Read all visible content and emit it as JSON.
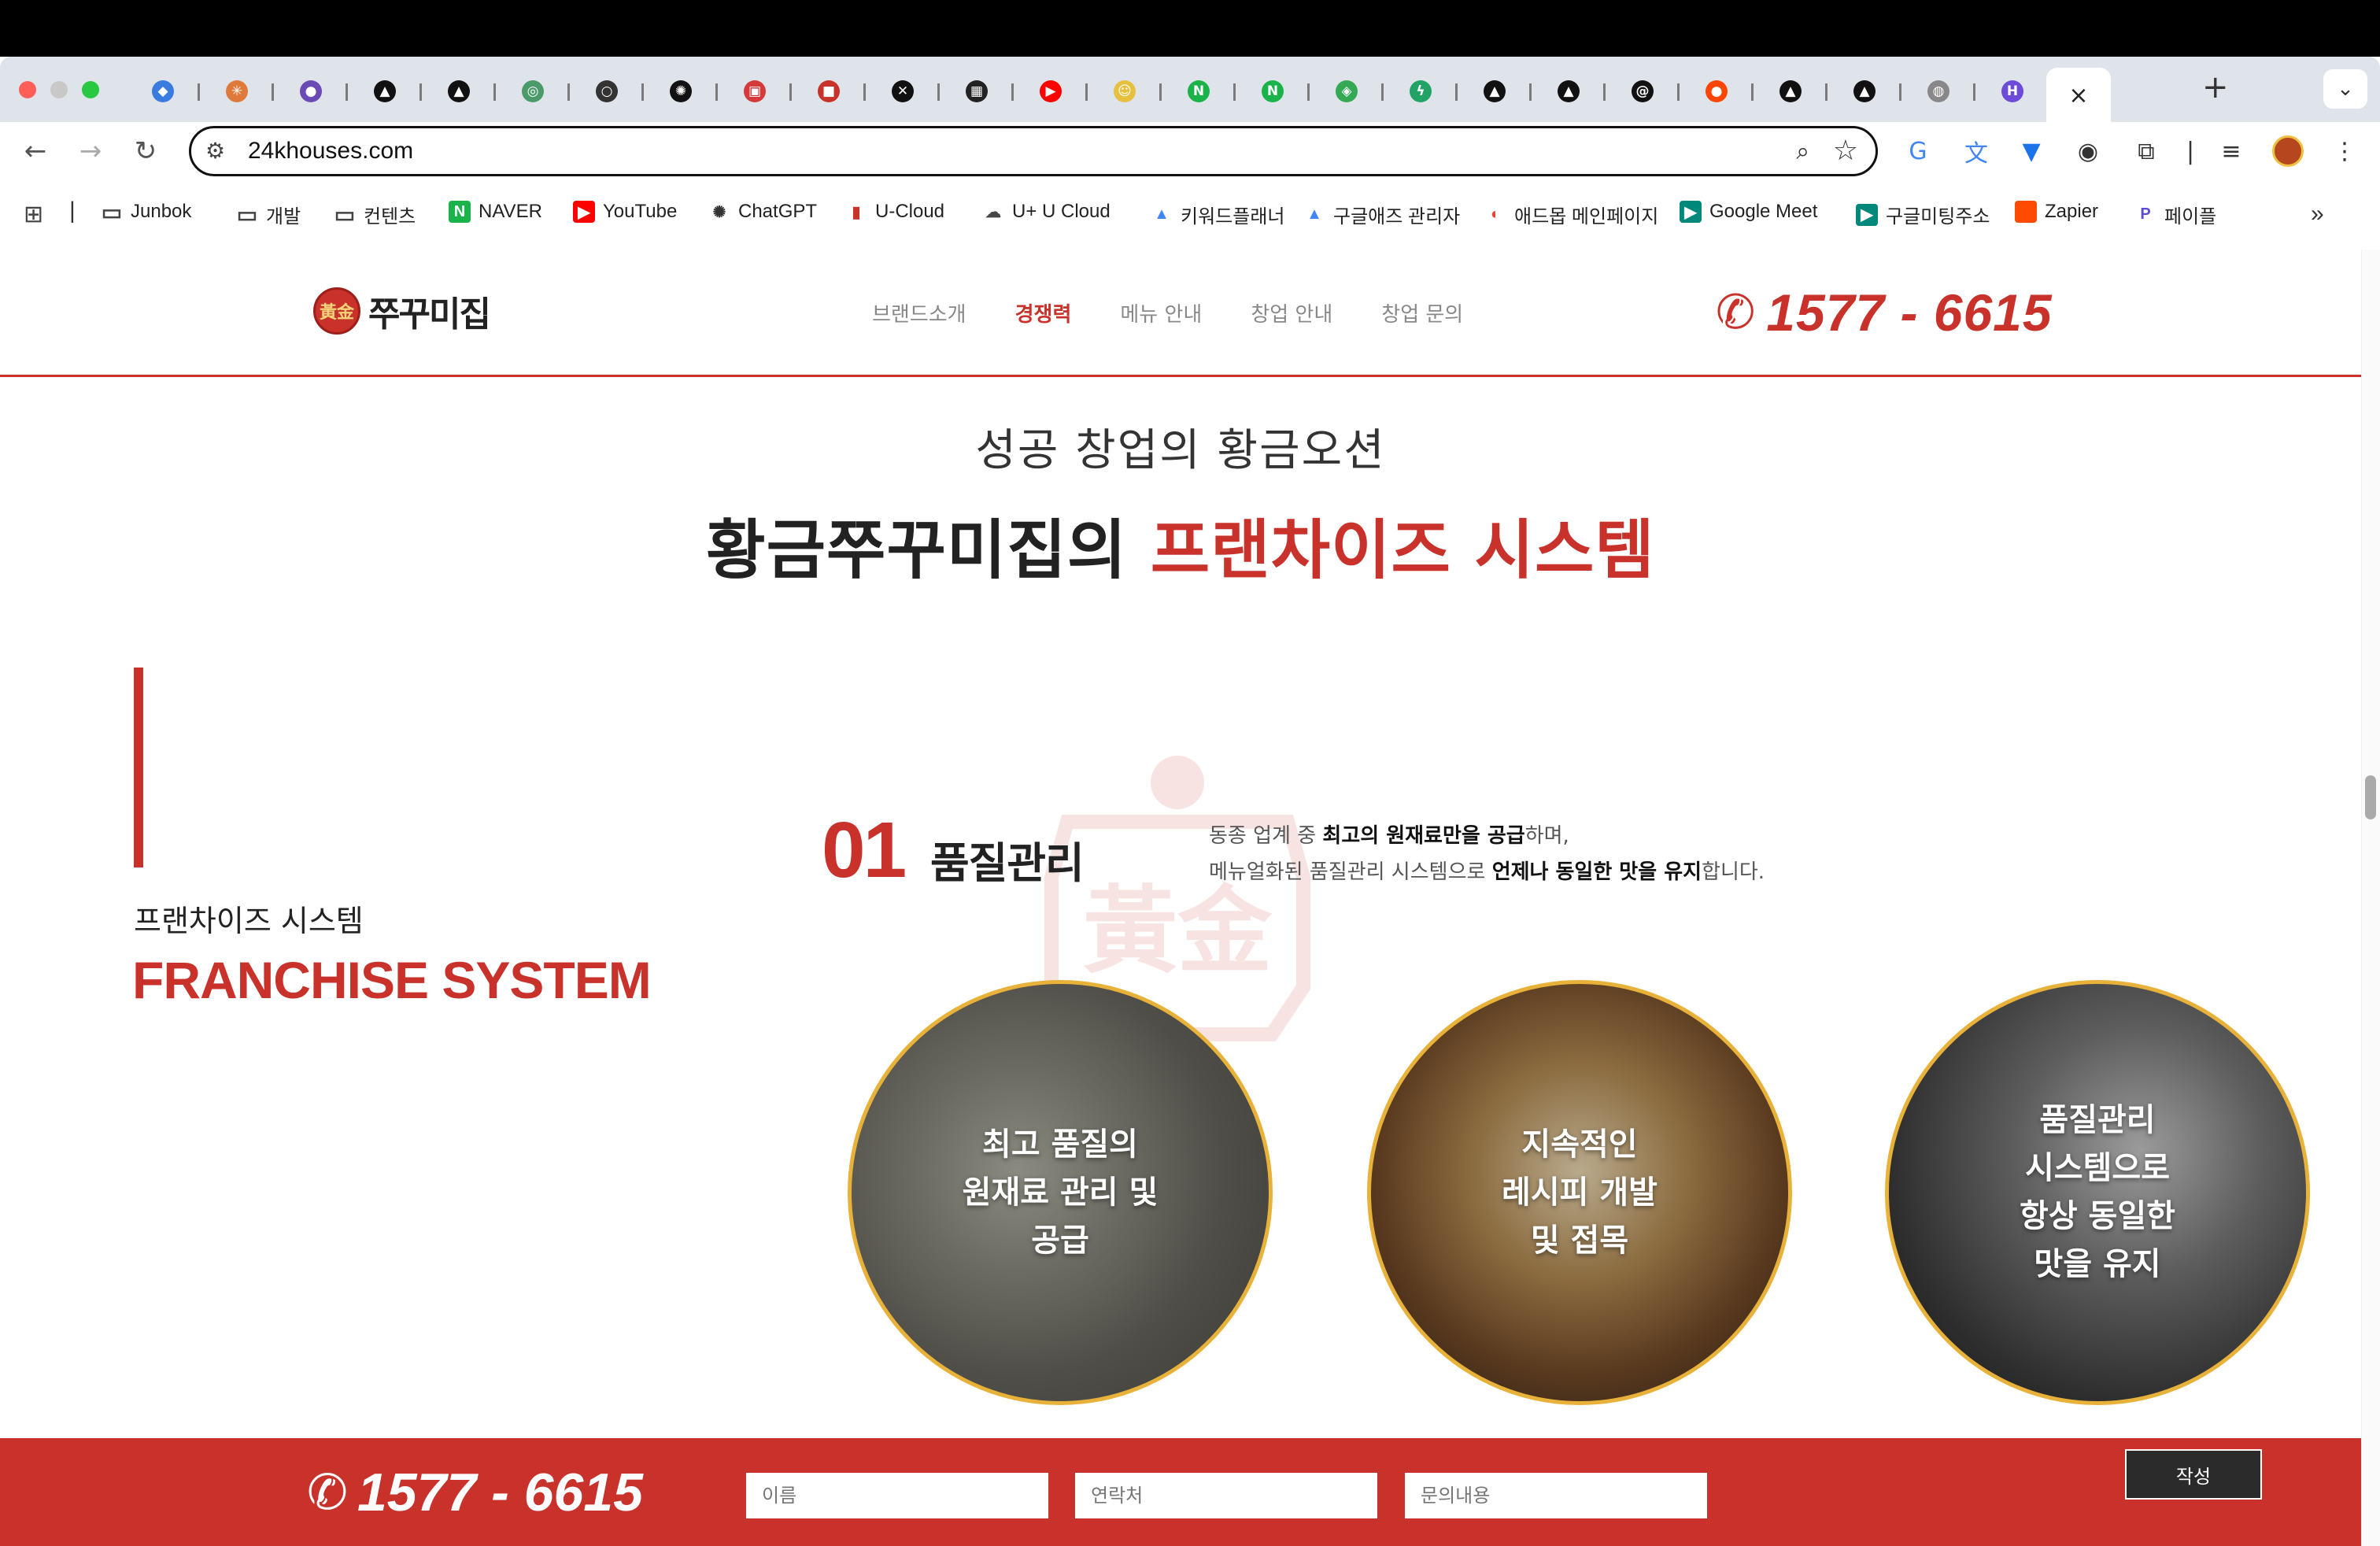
{
  "browser": {
    "url": "24khouses.com",
    "tab_icons": [
      "gem-icon",
      "burst-icon",
      "avatar-icon",
      "triangle-icon",
      "triangle-icon",
      "spiral-icon",
      "ring-icon",
      "openai-icon",
      "app-icon",
      "square-icon",
      "vscode-icon",
      "box-icon",
      "youtube-icon",
      "smile-icon",
      "naver-icon",
      "naver-icon",
      "diamond-icon",
      "bolt-icon",
      "triangle-icon",
      "triangle-icon",
      "threads-icon",
      "reddit-icon",
      "triangle-icon",
      "triangle-icon",
      "globe-icon",
      "h-icon"
    ],
    "active_tab_close": "×",
    "new_tab": "+",
    "bookmarks": [
      {
        "label": "Junbok",
        "icon": "folder-icon"
      },
      {
        "label": "개발",
        "icon": "folder-icon"
      },
      {
        "label": "컨텐츠",
        "icon": "folder-icon"
      },
      {
        "label": "NAVER",
        "icon": "naver-icon"
      },
      {
        "label": "YouTube",
        "icon": "youtube-icon"
      },
      {
        "label": "ChatGPT",
        "icon": "openai-icon"
      },
      {
        "label": "U-Cloud",
        "icon": "ucloud-icon"
      },
      {
        "label": "U+ U Cloud",
        "icon": "cloud-icon"
      },
      {
        "label": "키워드플래너",
        "icon": "google-ads-icon"
      },
      {
        "label": "구글애즈 관리자",
        "icon": "google-ads-icon"
      },
      {
        "label": "애드몹 메인페이지",
        "icon": "admob-icon"
      },
      {
        "label": "Google Meet",
        "icon": "meet-icon"
      },
      {
        "label": "구글미팅주소",
        "icon": "meet-icon"
      },
      {
        "label": "Zapier",
        "icon": "zapier-icon"
      },
      {
        "label": "페이플",
        "icon": "payple-icon"
      }
    ],
    "bookmarks_overflow": "»"
  },
  "site": {
    "logo_badge": "黃金",
    "logo_name": "쭈꾸미집",
    "nav": [
      "브랜드소개",
      "경쟁력",
      "메뉴 안내",
      "창업 안내",
      "창업 문의"
    ],
    "nav_active_index": 1,
    "phone": "1577 - 6615",
    "accent_color": "#c8322b"
  },
  "hero": {
    "subtitle": "성공 창업의 황금오션",
    "title_dark": "황금쭈꾸미집의 ",
    "title_red": "프랜차이즈 시스템"
  },
  "section": {
    "label_ko": "프랜차이즈 시스템",
    "label_en": "FRANCHISE SYSTEM",
    "number": "01",
    "title": "품질관리",
    "desc_line1_pre": "동종 업계 중 ",
    "desc_line1_bold": "최고의 원재료만을 공급",
    "desc_line1_post": "하며,",
    "desc_line2_pre": "메뉴얼화된 품질관리 시스템으로 ",
    "desc_line2_bold": "언제나 동일한 맛을 유지",
    "desc_line2_post": "합니다.",
    "watermark": "黃金",
    "circles": [
      {
        "lines": [
          "최고 품질의",
          "원재료 관리 및",
          "공급"
        ]
      },
      {
        "lines": [
          "지속적인",
          "레시피 개발",
          "및 접목"
        ]
      },
      {
        "lines": [
          "품질관리",
          "시스템으로",
          "항상 동일한",
          "맛을 유지"
        ]
      }
    ]
  },
  "footer": {
    "phone": "1577 - 6615",
    "name_placeholder": "이름",
    "contact_placeholder": "연락처",
    "message_placeholder": "문의내용",
    "submit_label": "작성"
  }
}
